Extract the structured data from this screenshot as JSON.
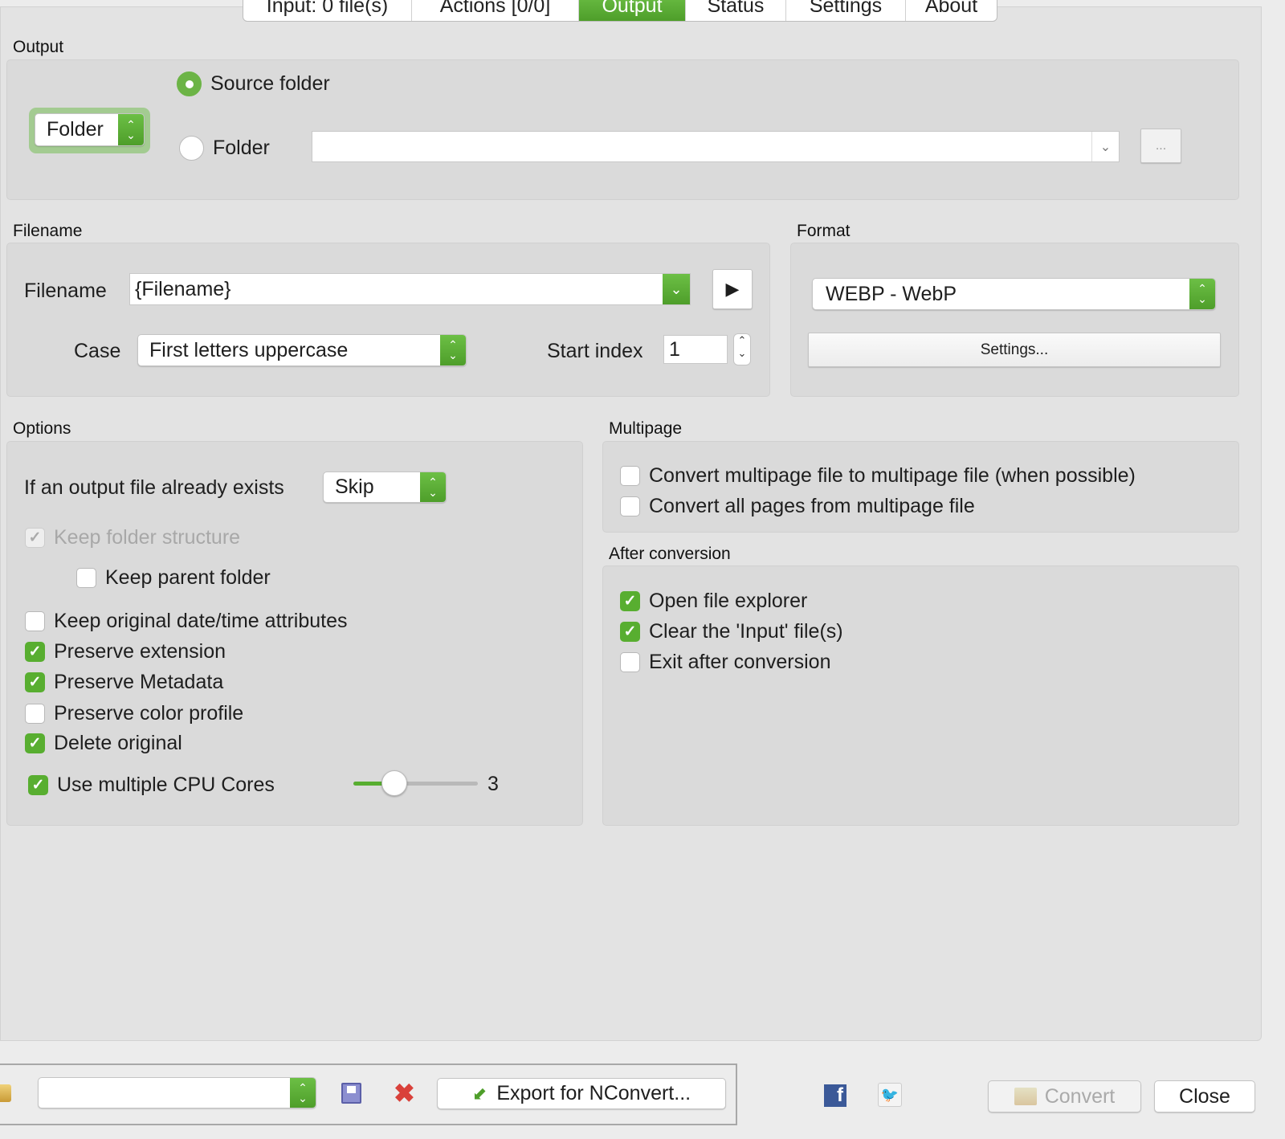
{
  "tabs": [
    "Input: 0 file(s)",
    "Actions [0/0]",
    "Output",
    "Status",
    "Settings",
    "About"
  ],
  "active_tab": "Output",
  "output": {
    "label": "Output",
    "mode_select": "Folder",
    "radio_source": "Source folder",
    "radio_folder": "Folder",
    "folder_value": "",
    "browse_label": "..."
  },
  "filename": {
    "label": "Filename",
    "field_label": "Filename",
    "value": "{Filename}",
    "case_label": "Case",
    "case_value": "First letters uppercase",
    "start_index_label": "Start index",
    "start_index": "1"
  },
  "format": {
    "label": "Format",
    "value": "WEBP - WebP",
    "settings_button": "Settings..."
  },
  "options": {
    "label": "Options",
    "exists_label": "If an output file already exists",
    "exists_value": "Skip",
    "items": [
      {
        "label": "Keep folder structure",
        "checked": true,
        "disabled": true
      },
      {
        "label": "Keep parent folder",
        "checked": false
      },
      {
        "label": "Keep original date/time attributes",
        "checked": false
      },
      {
        "label": "Preserve extension",
        "checked": true
      },
      {
        "label": "Preserve Metadata",
        "checked": true
      },
      {
        "label": "Preserve color profile",
        "checked": false
      },
      {
        "label": "Delete original",
        "checked": true
      }
    ],
    "cpu_label": "Use multiple CPU Cores",
    "cpu_checked": true,
    "cpu_value": "3",
    "cpu_fraction": 0.33
  },
  "multipage": {
    "label": "Multipage",
    "items": [
      {
        "label": "Convert multipage file to multipage file (when possible)",
        "checked": false
      },
      {
        "label": "Convert all pages from multipage file",
        "checked": false
      }
    ]
  },
  "after": {
    "label": "After conversion",
    "items": [
      {
        "label": "Open file explorer",
        "checked": true
      },
      {
        "label": "Clear the 'Input' file(s)",
        "checked": true
      },
      {
        "label": "Exit after conversion",
        "checked": false
      }
    ]
  },
  "bottom": {
    "preset_value": "",
    "export_label": "Export for NConvert...",
    "convert_label": "Convert",
    "close_label": "Close"
  },
  "colors": {
    "accent": "#58ae30"
  }
}
